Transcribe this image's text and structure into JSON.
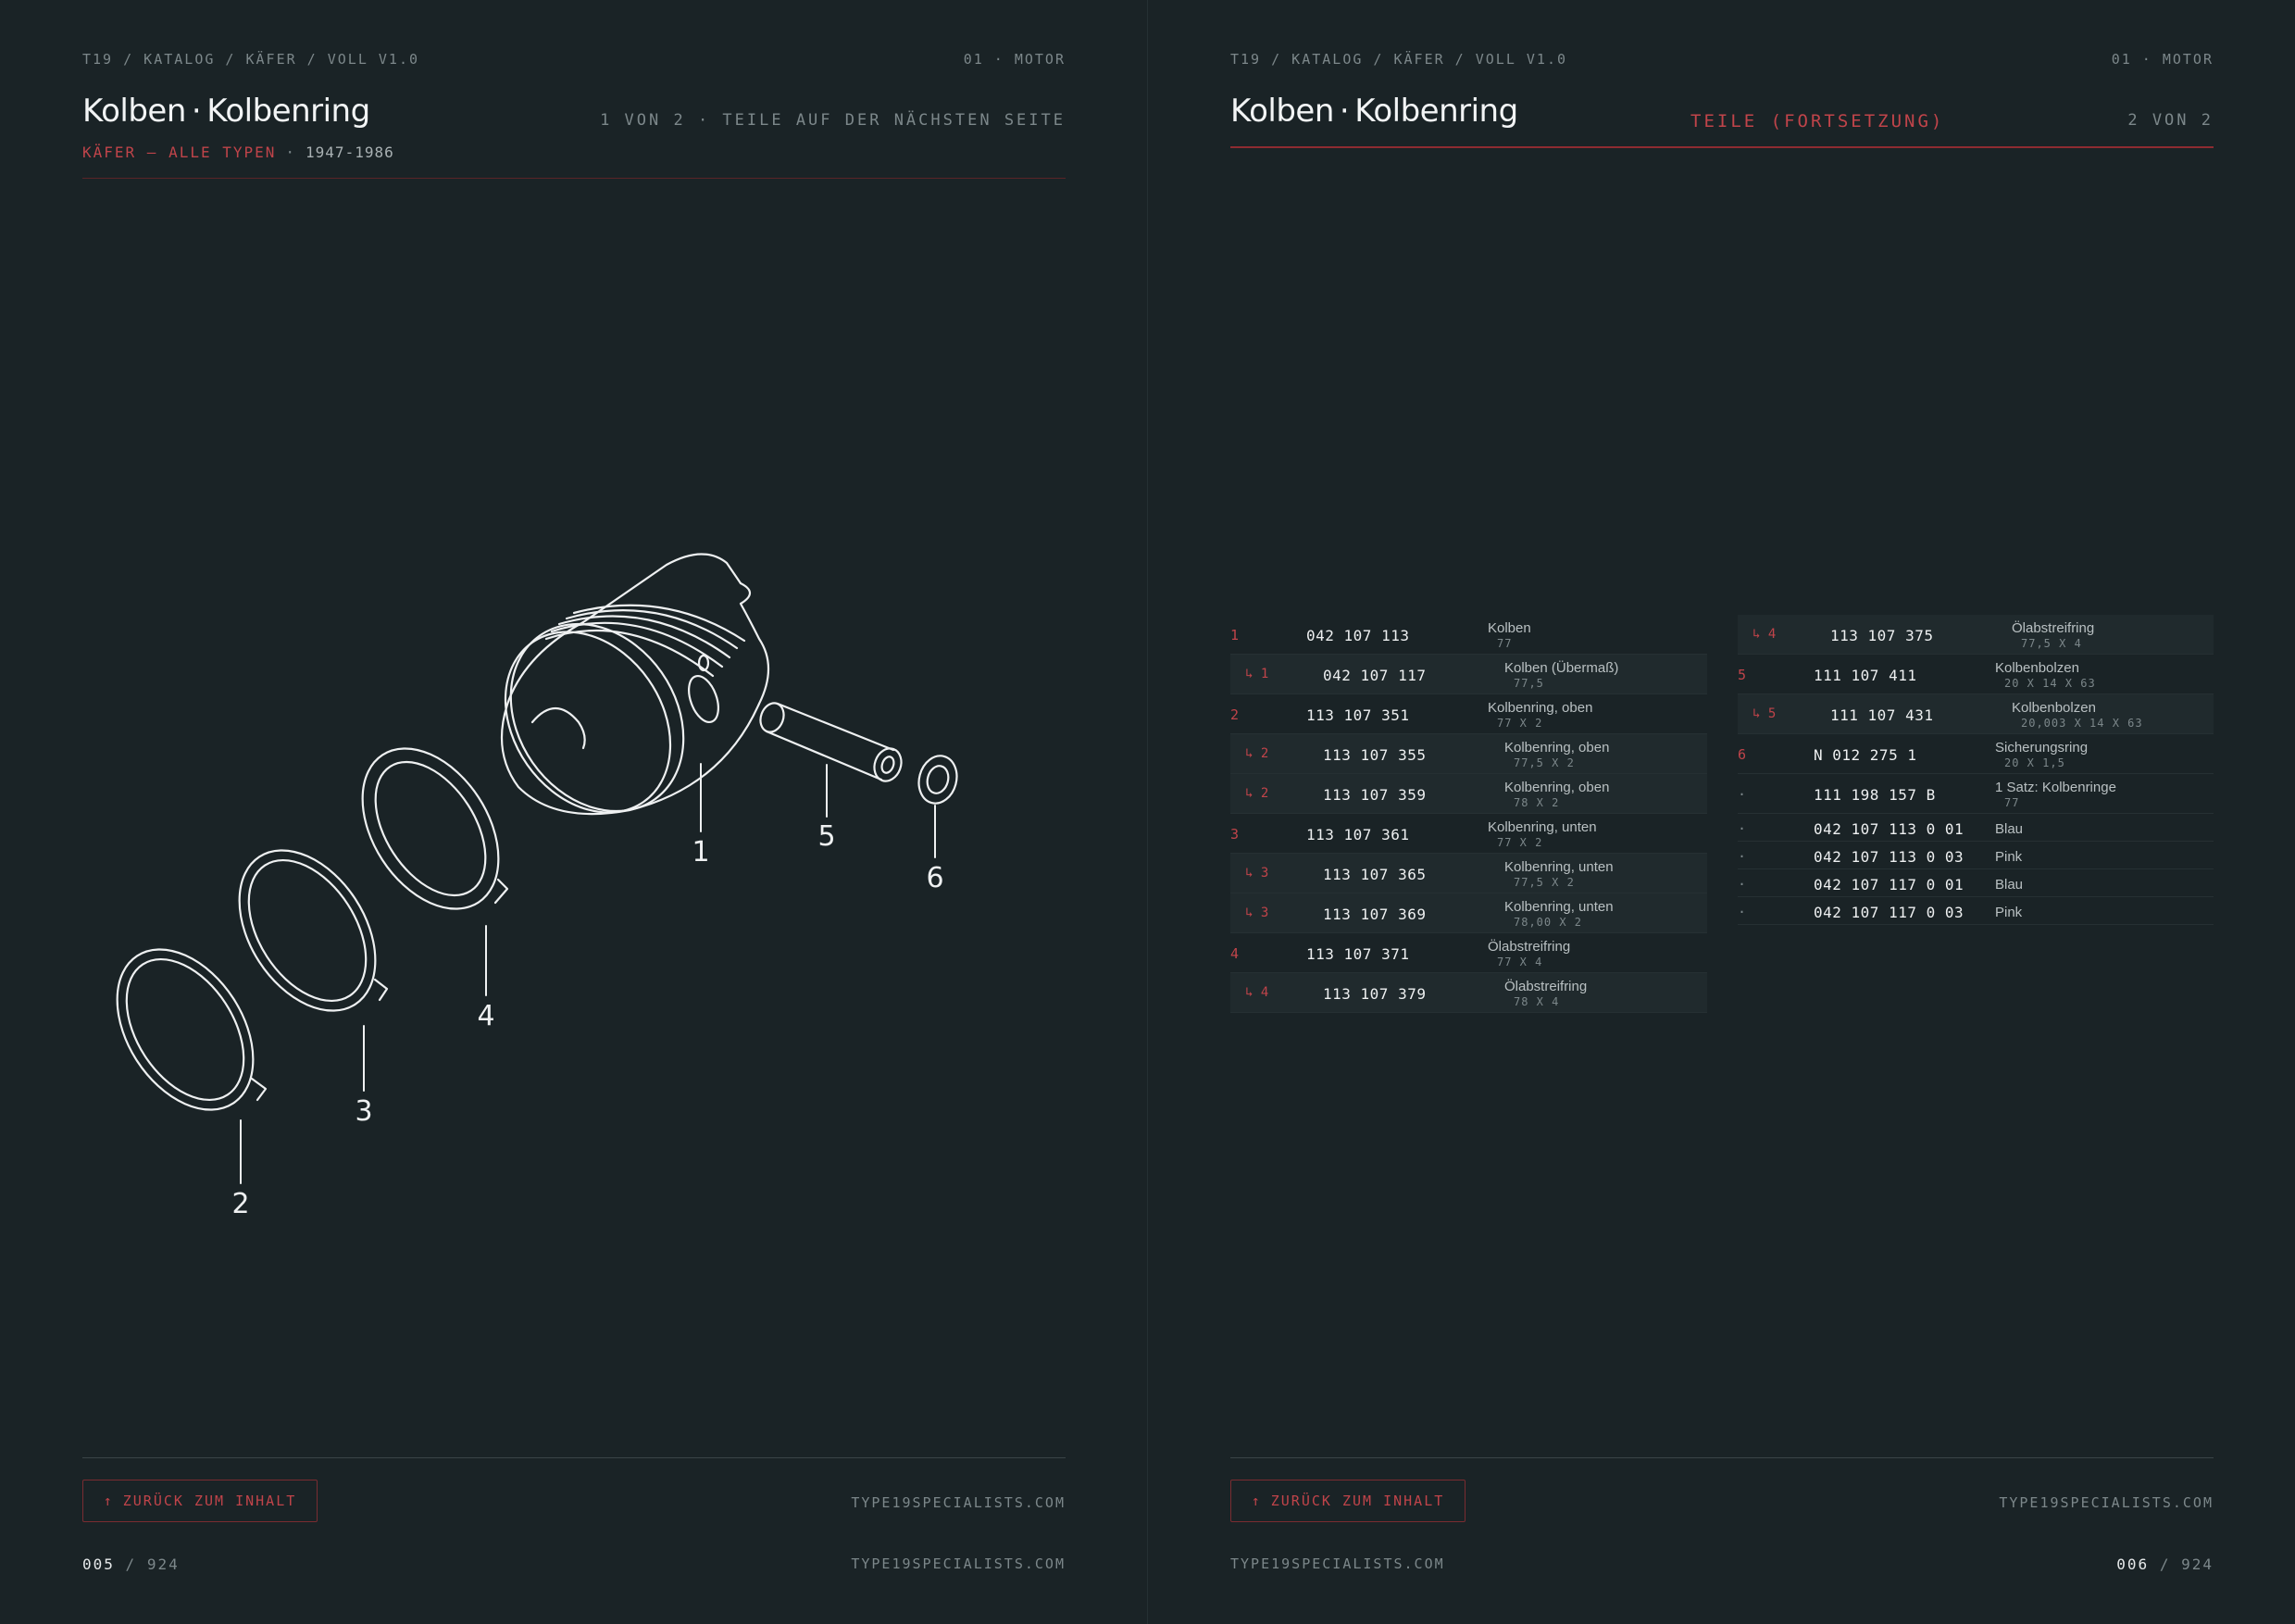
{
  "left": {
    "breadcrumb": "T19 / KATALOG / KÄFER / VOLL V1.0",
    "section": "01 · MOTOR",
    "title_a": "Kolben",
    "title_dot": "·",
    "title_b": "Kolbenring",
    "subtitle": "KÄFER — ALLE TYPEN",
    "subtitle_sep": "·",
    "years": "1947-1986",
    "page_info": "1 VON 2 · TEILE AUF DER NÄCHSTEN SEITE",
    "callouts": [
      "1",
      "5",
      "6",
      "4",
      "3",
      "2"
    ],
    "back_button": "ZURÜCK ZUM INHALT",
    "back_icon": "↑",
    "site_right": "TYPE19SPECIALISTS.COM",
    "site_bottom": "TYPE19SPECIALISTS.COM",
    "page_current": "005",
    "page_sep": " / ",
    "page_total": "924"
  },
  "right": {
    "breadcrumb": "T19 / KATALOG / KÄFER / VOLL V1.0",
    "section": "01 · MOTOR",
    "title_a": "Kolben",
    "title_dot": "·",
    "title_b": "Kolbenring",
    "continued": "TEILE (FORTSETZUNG)",
    "page_info": "2 VON 2",
    "back_button": "ZURÜCK ZUM INHALT",
    "back_icon": "↑",
    "site_right": "TYPE19SPECIALISTS.COM",
    "site_bottom": "TYPE19SPECIALISTS.COM",
    "page_current": "006",
    "page_sep": " / ",
    "page_total": "924",
    "parts_col1": [
      {
        "ref": "1",
        "pn": "042 107 113",
        "desc": "Kolben",
        "spec": "77"
      },
      {
        "ref": "↳ 1",
        "pn": "042 107 117",
        "desc": "Kolben (Übermaß)",
        "spec": "77,5"
      },
      {
        "ref": "2",
        "pn": "113 107 351",
        "desc": "Kolbenring, oben",
        "spec": "77 X 2"
      },
      {
        "ref": "↳ 2",
        "pn": "113 107 355",
        "desc": "Kolbenring, oben",
        "spec": "77,5 X 2"
      },
      {
        "ref": "↳ 2",
        "pn": "113 107 359",
        "desc": "Kolbenring, oben",
        "spec": "78 X 2"
      },
      {
        "ref": "3",
        "pn": "113 107 361",
        "desc": "Kolbenring, unten",
        "spec": "77 X 2"
      },
      {
        "ref": "↳ 3",
        "pn": "113 107 365",
        "desc": "Kolbenring, unten",
        "spec": "77,5 X 2"
      },
      {
        "ref": "↳ 3",
        "pn": "113 107 369",
        "desc": "Kolbenring, unten",
        "spec": "78,00 X 2"
      },
      {
        "ref": "4",
        "pn": "113 107 371",
        "desc": "Ölabstreifring",
        "spec": "77 X 4"
      },
      {
        "ref": "↳ 4",
        "pn": "113 107 379",
        "desc": "Ölabstreifring",
        "spec": "78 X 4"
      }
    ],
    "parts_col2": [
      {
        "ref": "↳ 4",
        "pn": "113 107 375",
        "desc": "Ölabstreifring",
        "spec": "77,5 X 4"
      },
      {
        "ref": "5",
        "pn": "111 107 411",
        "desc": "Kolbenbolzen",
        "spec": "20 X 14 X 63"
      },
      {
        "ref": "↳ 5",
        "pn": "111 107 431",
        "desc": "Kolbenbolzen",
        "spec": "20,003 X 14 X 63"
      },
      {
        "ref": "6",
        "pn": "N 012 275 1",
        "desc": "Sicherungsring",
        "spec": "20 X 1,5"
      },
      {
        "ref": "·",
        "pn": "111 198 157 B",
        "desc": "1 Satz: Kolbenringe",
        "spec": "77"
      },
      {
        "ref": "·",
        "pn": "042 107 113 0 01",
        "desc": "Blau",
        "spec": ""
      },
      {
        "ref": "·",
        "pn": "042 107 113 0 03",
        "desc": "Pink",
        "spec": ""
      },
      {
        "ref": "·",
        "pn": "042 107 117 0 01",
        "desc": "Blau",
        "spec": ""
      },
      {
        "ref": "·",
        "pn": "042 107 117 0 03",
        "desc": "Pink",
        "spec": ""
      }
    ]
  },
  "colors": {
    "background": "#1a2326",
    "accent_red": "#c0444a",
    "muted": "#7c878a",
    "text": "#e6e9ea"
  }
}
